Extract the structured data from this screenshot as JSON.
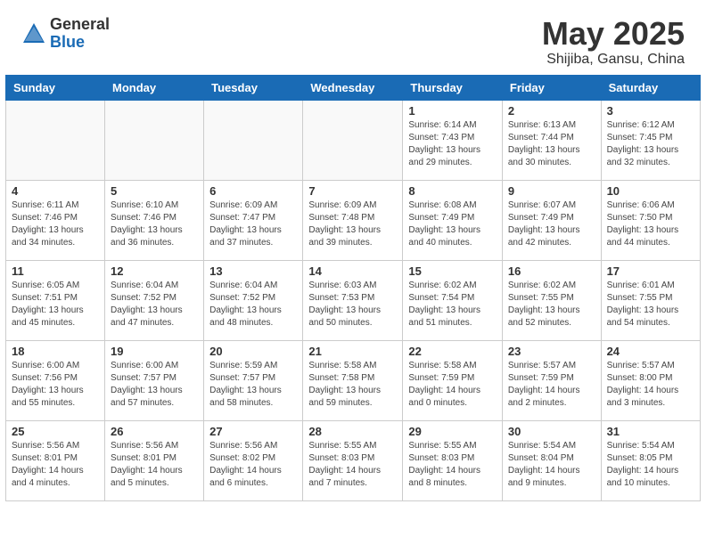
{
  "header": {
    "logo_general": "General",
    "logo_blue": "Blue",
    "month_year": "May 2025",
    "location": "Shijiba, Gansu, China"
  },
  "days_of_week": [
    "Sunday",
    "Monday",
    "Tuesday",
    "Wednesday",
    "Thursday",
    "Friday",
    "Saturday"
  ],
  "weeks": [
    [
      {
        "day": "",
        "info": ""
      },
      {
        "day": "",
        "info": ""
      },
      {
        "day": "",
        "info": ""
      },
      {
        "day": "",
        "info": ""
      },
      {
        "day": "1",
        "info": "Sunrise: 6:14 AM\nSunset: 7:43 PM\nDaylight: 13 hours\nand 29 minutes."
      },
      {
        "day": "2",
        "info": "Sunrise: 6:13 AM\nSunset: 7:44 PM\nDaylight: 13 hours\nand 30 minutes."
      },
      {
        "day": "3",
        "info": "Sunrise: 6:12 AM\nSunset: 7:45 PM\nDaylight: 13 hours\nand 32 minutes."
      }
    ],
    [
      {
        "day": "4",
        "info": "Sunrise: 6:11 AM\nSunset: 7:46 PM\nDaylight: 13 hours\nand 34 minutes."
      },
      {
        "day": "5",
        "info": "Sunrise: 6:10 AM\nSunset: 7:46 PM\nDaylight: 13 hours\nand 36 minutes."
      },
      {
        "day": "6",
        "info": "Sunrise: 6:09 AM\nSunset: 7:47 PM\nDaylight: 13 hours\nand 37 minutes."
      },
      {
        "day": "7",
        "info": "Sunrise: 6:09 AM\nSunset: 7:48 PM\nDaylight: 13 hours\nand 39 minutes."
      },
      {
        "day": "8",
        "info": "Sunrise: 6:08 AM\nSunset: 7:49 PM\nDaylight: 13 hours\nand 40 minutes."
      },
      {
        "day": "9",
        "info": "Sunrise: 6:07 AM\nSunset: 7:49 PM\nDaylight: 13 hours\nand 42 minutes."
      },
      {
        "day": "10",
        "info": "Sunrise: 6:06 AM\nSunset: 7:50 PM\nDaylight: 13 hours\nand 44 minutes."
      }
    ],
    [
      {
        "day": "11",
        "info": "Sunrise: 6:05 AM\nSunset: 7:51 PM\nDaylight: 13 hours\nand 45 minutes."
      },
      {
        "day": "12",
        "info": "Sunrise: 6:04 AM\nSunset: 7:52 PM\nDaylight: 13 hours\nand 47 minutes."
      },
      {
        "day": "13",
        "info": "Sunrise: 6:04 AM\nSunset: 7:52 PM\nDaylight: 13 hours\nand 48 minutes."
      },
      {
        "day": "14",
        "info": "Sunrise: 6:03 AM\nSunset: 7:53 PM\nDaylight: 13 hours\nand 50 minutes."
      },
      {
        "day": "15",
        "info": "Sunrise: 6:02 AM\nSunset: 7:54 PM\nDaylight: 13 hours\nand 51 minutes."
      },
      {
        "day": "16",
        "info": "Sunrise: 6:02 AM\nSunset: 7:55 PM\nDaylight: 13 hours\nand 52 minutes."
      },
      {
        "day": "17",
        "info": "Sunrise: 6:01 AM\nSunset: 7:55 PM\nDaylight: 13 hours\nand 54 minutes."
      }
    ],
    [
      {
        "day": "18",
        "info": "Sunrise: 6:00 AM\nSunset: 7:56 PM\nDaylight: 13 hours\nand 55 minutes."
      },
      {
        "day": "19",
        "info": "Sunrise: 6:00 AM\nSunset: 7:57 PM\nDaylight: 13 hours\nand 57 minutes."
      },
      {
        "day": "20",
        "info": "Sunrise: 5:59 AM\nSunset: 7:57 PM\nDaylight: 13 hours\nand 58 minutes."
      },
      {
        "day": "21",
        "info": "Sunrise: 5:58 AM\nSunset: 7:58 PM\nDaylight: 13 hours\nand 59 minutes."
      },
      {
        "day": "22",
        "info": "Sunrise: 5:58 AM\nSunset: 7:59 PM\nDaylight: 14 hours\nand 0 minutes."
      },
      {
        "day": "23",
        "info": "Sunrise: 5:57 AM\nSunset: 7:59 PM\nDaylight: 14 hours\nand 2 minutes."
      },
      {
        "day": "24",
        "info": "Sunrise: 5:57 AM\nSunset: 8:00 PM\nDaylight: 14 hours\nand 3 minutes."
      }
    ],
    [
      {
        "day": "25",
        "info": "Sunrise: 5:56 AM\nSunset: 8:01 PM\nDaylight: 14 hours\nand 4 minutes."
      },
      {
        "day": "26",
        "info": "Sunrise: 5:56 AM\nSunset: 8:01 PM\nDaylight: 14 hours\nand 5 minutes."
      },
      {
        "day": "27",
        "info": "Sunrise: 5:56 AM\nSunset: 8:02 PM\nDaylight: 14 hours\nand 6 minutes."
      },
      {
        "day": "28",
        "info": "Sunrise: 5:55 AM\nSunset: 8:03 PM\nDaylight: 14 hours\nand 7 minutes."
      },
      {
        "day": "29",
        "info": "Sunrise: 5:55 AM\nSunset: 8:03 PM\nDaylight: 14 hours\nand 8 minutes."
      },
      {
        "day": "30",
        "info": "Sunrise: 5:54 AM\nSunset: 8:04 PM\nDaylight: 14 hours\nand 9 minutes."
      },
      {
        "day": "31",
        "info": "Sunrise: 5:54 AM\nSunset: 8:05 PM\nDaylight: 14 hours\nand 10 minutes."
      }
    ]
  ]
}
